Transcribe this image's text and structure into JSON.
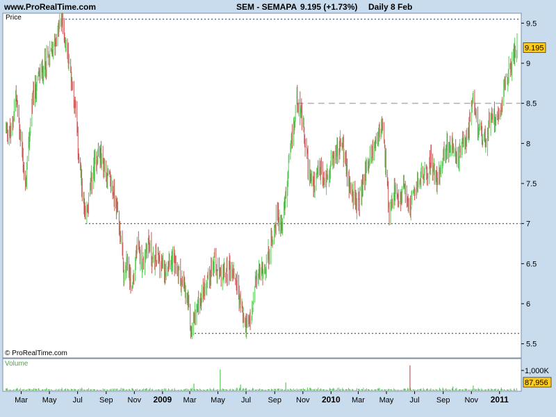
{
  "header": {
    "site": "www.ProRealTime.com",
    "instrument": "SEM - SEMAPA",
    "last_info": "9.195 (+1.73%)",
    "period": "Daily  8 Feb"
  },
  "price_panel": {
    "label": "Price",
    "last_value_label": "9.195",
    "copyright": "© ProRealTime.com"
  },
  "volume_panel": {
    "label": "Volume",
    "scale_label": "1,000K",
    "last_value_label": "87,956"
  },
  "colors": {
    "background": "#c8dcee",
    "panel": "#ffffff",
    "up_bar": "#55cc55",
    "down_bar": "#cc5555",
    "volume_bar": "#55cc55",
    "blue_level": "#2a6fb0",
    "gray_level": "#666666",
    "light_level": "#b0b0b0",
    "last_value_box": "#ffcc22"
  },
  "chart_data": {
    "type": "line",
    "title": "SEM - SEMAPA",
    "xlabel": "",
    "ylabel": "Price",
    "ylim": [
      5.5,
      9.7
    ],
    "yticks": [
      5.5,
      6,
      6.5,
      7,
      7.5,
      8,
      8.5,
      9,
      9.5
    ],
    "xticks": [
      {
        "label": "Mar",
        "date": "2008-03-01"
      },
      {
        "label": "May",
        "date": "2008-05-01"
      },
      {
        "label": "Jul",
        "date": "2008-07-01"
      },
      {
        "label": "Sep",
        "date": "2008-09-01"
      },
      {
        "label": "Nov",
        "date": "2008-11-01"
      },
      {
        "label": "2009",
        "date": "2009-01-01",
        "bold": true
      },
      {
        "label": "Mar",
        "date": "2009-03-01"
      },
      {
        "label": "May",
        "date": "2009-05-01"
      },
      {
        "label": "Jul",
        "date": "2009-07-01"
      },
      {
        "label": "Sep",
        "date": "2009-09-01"
      },
      {
        "label": "Nov",
        "date": "2009-11-01"
      },
      {
        "label": "2010",
        "date": "2010-01-01",
        "bold": true
      },
      {
        "label": "Mar",
        "date": "2010-03-01"
      },
      {
        "label": "May",
        "date": "2010-05-01"
      },
      {
        "label": "Jul",
        "date": "2010-07-01"
      },
      {
        "label": "Sep",
        "date": "2010-09-01"
      },
      {
        "label": "Nov",
        "date": "2010-11-01"
      },
      {
        "label": "2011",
        "date": "2011-01-01",
        "bold": true
      }
    ],
    "series": [
      {
        "values": [
          [
            "2008-01-28",
            8.2
          ],
          [
            "2008-02-08",
            8.1
          ],
          [
            "2008-02-18",
            8.6
          ],
          [
            "2008-03-03",
            7.9
          ],
          [
            "2008-03-10",
            7.4
          ],
          [
            "2008-03-24",
            8.5
          ],
          [
            "2008-04-07",
            8.8
          ],
          [
            "2008-04-21",
            9.0
          ],
          [
            "2008-05-05",
            9.1
          ],
          [
            "2008-05-20",
            9.4
          ],
          [
            "2008-05-28",
            9.55
          ],
          [
            "2008-06-06",
            9.2
          ],
          [
            "2008-06-16",
            8.9
          ],
          [
            "2008-06-27",
            8.4
          ],
          [
            "2008-07-04",
            7.8
          ],
          [
            "2008-07-11",
            7.4
          ],
          [
            "2008-07-18",
            7.0
          ],
          [
            "2008-07-25",
            7.3
          ],
          [
            "2008-08-05",
            7.7
          ],
          [
            "2008-08-15",
            7.9
          ],
          [
            "2008-08-28",
            7.7
          ],
          [
            "2008-09-10",
            7.5
          ],
          [
            "2008-09-22",
            7.3
          ],
          [
            "2008-10-01",
            6.9
          ],
          [
            "2008-10-10",
            6.3
          ],
          [
            "2008-10-17",
            6.5
          ],
          [
            "2008-10-27",
            6.2
          ],
          [
            "2008-11-07",
            6.7
          ],
          [
            "2008-11-20",
            6.5
          ],
          [
            "2008-12-01",
            6.8
          ],
          [
            "2008-12-12",
            6.5
          ],
          [
            "2008-12-22",
            6.6
          ],
          [
            "2009-01-05",
            6.4
          ],
          [
            "2009-01-15",
            6.6
          ],
          [
            "2009-01-26",
            6.5
          ],
          [
            "2009-02-05",
            6.4
          ],
          [
            "2009-02-16",
            6.2
          ],
          [
            "2009-02-25",
            6.0
          ],
          [
            "2009-03-04",
            5.65
          ],
          [
            "2009-03-10",
            5.8
          ],
          [
            "2009-03-20",
            6.0
          ],
          [
            "2009-04-01",
            6.2
          ],
          [
            "2009-04-14",
            6.4
          ],
          [
            "2009-04-23",
            6.5
          ],
          [
            "2009-05-06",
            6.3
          ],
          [
            "2009-05-18",
            6.4
          ],
          [
            "2009-05-28",
            6.45
          ],
          [
            "2009-06-10",
            6.3
          ],
          [
            "2009-06-19",
            6.0
          ],
          [
            "2009-06-26",
            5.8
          ],
          [
            "2009-07-03",
            5.7
          ],
          [
            "2009-07-14",
            5.85
          ],
          [
            "2009-07-22",
            6.3
          ],
          [
            "2009-08-03",
            6.4
          ],
          [
            "2009-08-14",
            6.5
          ],
          [
            "2009-08-26",
            6.8
          ],
          [
            "2009-09-05",
            7.1
          ],
          [
            "2009-09-15",
            7.0
          ],
          [
            "2009-09-25",
            7.3
          ],
          [
            "2009-10-05",
            7.9
          ],
          [
            "2009-10-12",
            8.2
          ],
          [
            "2009-10-20",
            8.6
          ],
          [
            "2009-10-27",
            8.4
          ],
          [
            "2009-11-06",
            8.0
          ],
          [
            "2009-11-16",
            7.6
          ],
          [
            "2009-11-26",
            7.4
          ],
          [
            "2009-12-07",
            7.7
          ],
          [
            "2009-12-18",
            7.5
          ],
          [
            "2010-01-04",
            7.8
          ],
          [
            "2010-01-15",
            7.9
          ],
          [
            "2010-01-26",
            8.0
          ],
          [
            "2010-02-05",
            7.6
          ],
          [
            "2010-02-16",
            7.4
          ],
          [
            "2010-02-25",
            7.2
          ],
          [
            "2010-03-08",
            7.4
          ],
          [
            "2010-03-19",
            7.7
          ],
          [
            "2010-04-01",
            7.9
          ],
          [
            "2010-04-13",
            8.1
          ],
          [
            "2010-04-22",
            8.2
          ],
          [
            "2010-05-03",
            7.5
          ],
          [
            "2010-05-07",
            7.0
          ],
          [
            "2010-05-18",
            7.4
          ],
          [
            "2010-05-28",
            7.2
          ],
          [
            "2010-06-08",
            7.5
          ],
          [
            "2010-06-21",
            7.2
          ],
          [
            "2010-07-02",
            7.4
          ],
          [
            "2010-07-14",
            7.6
          ],
          [
            "2010-07-26",
            7.6
          ],
          [
            "2010-08-06",
            7.8
          ],
          [
            "2010-08-18",
            7.5
          ],
          [
            "2010-08-30",
            7.8
          ],
          [
            "2010-09-10",
            8.0
          ],
          [
            "2010-09-22",
            7.9
          ],
          [
            "2010-10-04",
            7.8
          ],
          [
            "2010-10-15",
            8.0
          ],
          [
            "2010-10-27",
            8.2
          ],
          [
            "2010-11-05",
            8.5
          ],
          [
            "2010-11-12",
            8.3
          ],
          [
            "2010-11-24",
            8.1
          ],
          [
            "2010-12-03",
            8.0
          ],
          [
            "2010-12-14",
            8.4
          ],
          [
            "2010-12-23",
            8.3
          ],
          [
            "2011-01-05",
            8.5
          ],
          [
            "2011-01-14",
            8.8
          ],
          [
            "2011-01-24",
            8.9
          ],
          [
            "2011-02-01",
            9.1
          ],
          [
            "2011-02-08",
            9.195
          ]
        ]
      }
    ],
    "levels": [
      {
        "value": 9.55,
        "from": "2008-05-28",
        "style": "dotted-blue"
      },
      {
        "value": 8.5,
        "from": "2009-10-20",
        "style": "dashed-light"
      },
      {
        "value": 7.0,
        "from": "2008-07-18",
        "style": "dotted-gray"
      },
      {
        "value": 5.63,
        "from": "2009-03-04",
        "style": "dotted-gray"
      }
    ],
    "last_value": 9.195,
    "volume": {
      "ylim": [
        0,
        1400000
      ],
      "ytick": 1000000,
      "last": 87956,
      "spikes": [
        [
          "2009-03-10",
          350000
        ],
        [
          "2009-05-06",
          1050000
        ],
        [
          "2009-06-19",
          300000
        ],
        [
          "2009-09-25",
          400000
        ],
        [
          "2010-06-21",
          1250000
        ],
        [
          "2010-09-22",
          200000
        ],
        [
          "2010-11-05",
          250000
        ],
        [
          "2011-01-05",
          150000
        ]
      ]
    }
  }
}
